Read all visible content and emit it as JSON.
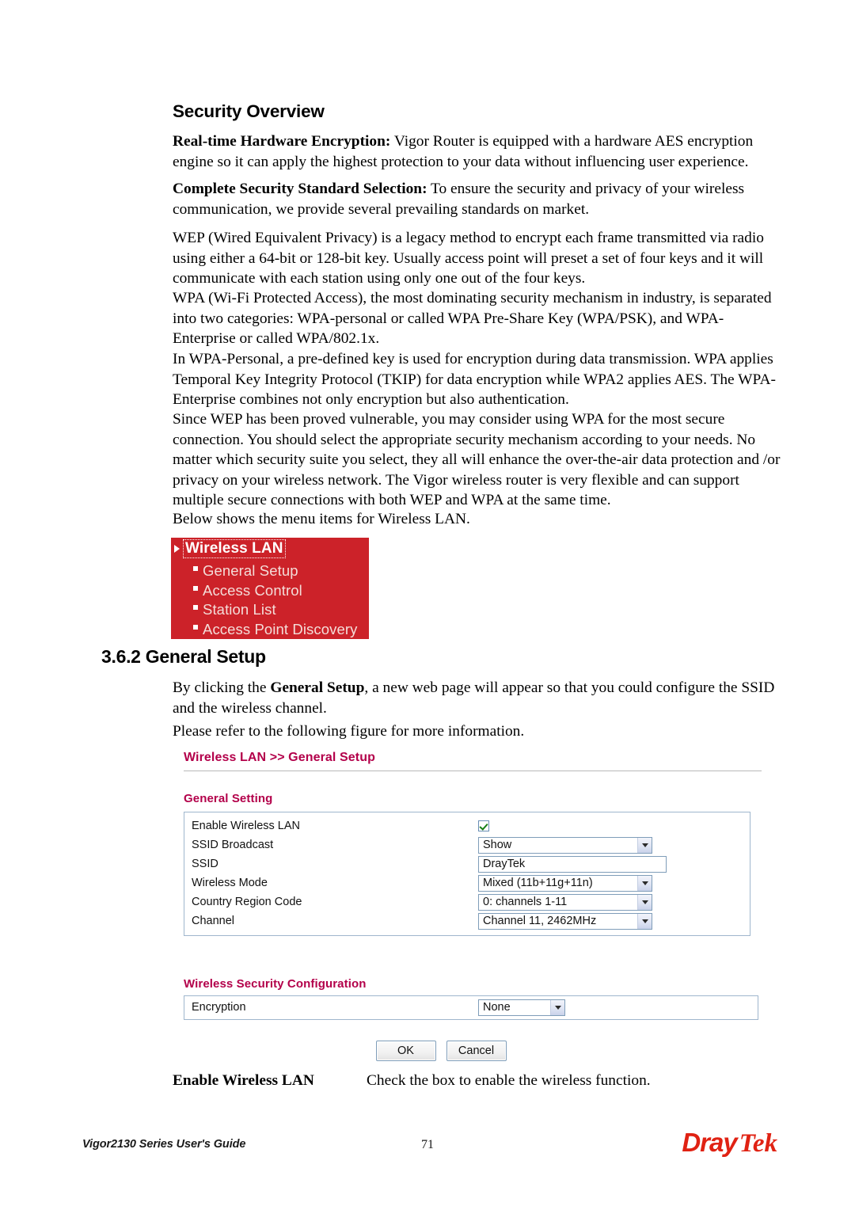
{
  "document": {
    "heading_overview": "Security Overview",
    "section_number_title": "3.6.2 General Setup"
  },
  "paragraphs": {
    "p1_bold": "Real-time Hardware Encryption:",
    "p1_text": " Vigor Router is equipped with a hardware AES encryption engine so it can apply the highest protection to your data without influencing user experience.",
    "p2_bold": "Complete Security Standard Selection:",
    "p2_text": " To ensure the security and privacy of your wireless communication, we provide several prevailing standards on market.",
    "p3": "WEP (Wired Equivalent Privacy) is a legacy method to encrypt each frame transmitted via radio using either a 64-bit or 128-bit key. Usually access point will preset a set of four keys and it will communicate with each station using only one out of the four keys.",
    "p4": "WPA (Wi-Fi Protected Access), the most dominating security mechanism in industry, is separated into two categories: WPA-personal or called WPA Pre-Share Key (WPA/PSK), and WPA-Enterprise or called WPA/802.1x.",
    "p5": "In WPA-Personal, a pre-defined key is used for encryption during data transmission. WPA applies Temporal Key Integrity Protocol (TKIP) for data encryption while WPA2 applies AES. The WPA-Enterprise combines not only encryption but also authentication.",
    "p6": "Since WEP has been proved vulnerable, you may consider using WPA for the most secure connection. You should select the appropriate security mechanism according to your needs. No matter which security suite you select, they all will enhance the over-the-air data protection and /or privacy on your wireless network. The Vigor wireless router is very flexible and can support multiple secure connections with both WEP and WPA at the same time.",
    "p7": "Below shows the menu items for Wireless LAN.",
    "gs1_pre": "By clicking the ",
    "gs1_bold": "General Setup",
    "gs1_post": ", a new web page will appear so that you could configure the SSID and the wireless channel.",
    "gs2": "Please refer to the following figure for more information."
  },
  "menu_box": {
    "top_item": "Wireless LAN",
    "sub_items": [
      "General Setup",
      "Access Control",
      "Station List",
      "Access Point Discovery"
    ]
  },
  "router_ui": {
    "breadcrumb": "Wireless LAN >> General Setup",
    "general_setting_title": "General Setting",
    "fields": [
      {
        "label": "Enable Wireless LAN",
        "type": "checkbox",
        "checked": true
      },
      {
        "label": "SSID Broadcast",
        "type": "select",
        "value": "Show"
      },
      {
        "label": "SSID",
        "type": "text",
        "value": "DrayTek"
      },
      {
        "label": "Wireless Mode",
        "type": "select",
        "value": "Mixed (11b+11g+11n)"
      },
      {
        "label": "Country Region Code",
        "type": "select",
        "value": "0: channels 1-11"
      },
      {
        "label": "Channel",
        "type": "select",
        "value": "Channel 11, 2462MHz"
      }
    ],
    "security_title": "Wireless Security Configuration",
    "security_field": {
      "label": "Encryption",
      "value": "None"
    },
    "buttons": {
      "ok": "OK",
      "cancel": "Cancel"
    }
  },
  "definition": {
    "term": "Enable Wireless LAN",
    "description": "Check the box to enable the wireless function."
  },
  "footer": {
    "guide": "Vigor2130 Series User's Guide",
    "page_number": "71",
    "logo_first": "Dray",
    "logo_second": "Tek"
  },
  "colors": {
    "menu_red": "#cc2229",
    "heading_magenta": "#b3004a",
    "logo_red": "#e02213"
  }
}
